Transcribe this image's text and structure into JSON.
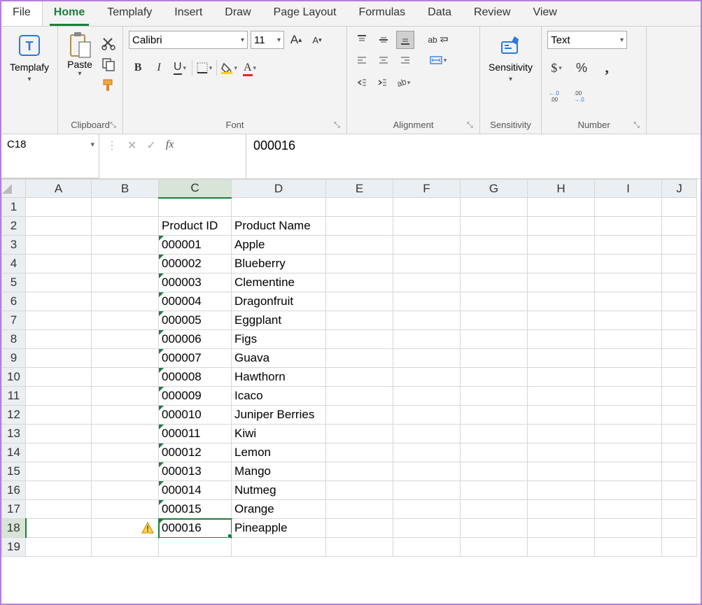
{
  "menu": [
    "File",
    "Home",
    "Templafy",
    "Insert",
    "Draw",
    "Page Layout",
    "Formulas",
    "Data",
    "Review",
    "View"
  ],
  "active_tab": "Home",
  "ribbon": {
    "templafy": {
      "label": "Templafy"
    },
    "clipboard": {
      "paste": "Paste",
      "label": "Clipboard"
    },
    "font": {
      "name": "Calibri",
      "size": "11",
      "label": "Font"
    },
    "alignment": {
      "wrap": "ab",
      "label": "Alignment"
    },
    "sensitivity": {
      "btn": "Sensitivity",
      "label": "Sensitivity"
    },
    "number": {
      "format": "Text",
      "label": "Number"
    }
  },
  "formula_bar": {
    "cell_ref": "C18",
    "value": "000016"
  },
  "columns": [
    "A",
    "B",
    "C",
    "D",
    "E",
    "F",
    "G",
    "H",
    "I",
    "J"
  ],
  "selected_col": "C",
  "selected_row": 18,
  "headers": {
    "c": "Product ID",
    "d": "Product Name"
  },
  "rows": [
    {
      "n": 1
    },
    {
      "n": 2,
      "c": "Product ID",
      "d": "Product Name",
      "hdr": true
    },
    {
      "n": 3,
      "c": "000001",
      "d": "Apple"
    },
    {
      "n": 4,
      "c": "000002",
      "d": "Blueberry"
    },
    {
      "n": 5,
      "c": "000003",
      "d": "Clementine"
    },
    {
      "n": 6,
      "c": "000004",
      "d": "Dragonfruit"
    },
    {
      "n": 7,
      "c": "000005",
      "d": "Eggplant"
    },
    {
      "n": 8,
      "c": "000006",
      "d": "Figs"
    },
    {
      "n": 9,
      "c": "000007",
      "d": "Guava"
    },
    {
      "n": 10,
      "c": "000008",
      "d": "Hawthorn"
    },
    {
      "n": 11,
      "c": "000009",
      "d": "Icaco"
    },
    {
      "n": 12,
      "c": "000010",
      "d": "Juniper Berries"
    },
    {
      "n": 13,
      "c": "000011",
      "d": "Kiwi"
    },
    {
      "n": 14,
      "c": "000012",
      "d": "Lemon"
    },
    {
      "n": 15,
      "c": "000013",
      "d": "Mango"
    },
    {
      "n": 16,
      "c": "000014",
      "d": "Nutmeg"
    },
    {
      "n": 17,
      "c": "000015",
      "d": "Orange"
    },
    {
      "n": 18,
      "c": "000016",
      "d": "Pineapple",
      "sel": true,
      "warn": true
    },
    {
      "n": 19
    }
  ]
}
